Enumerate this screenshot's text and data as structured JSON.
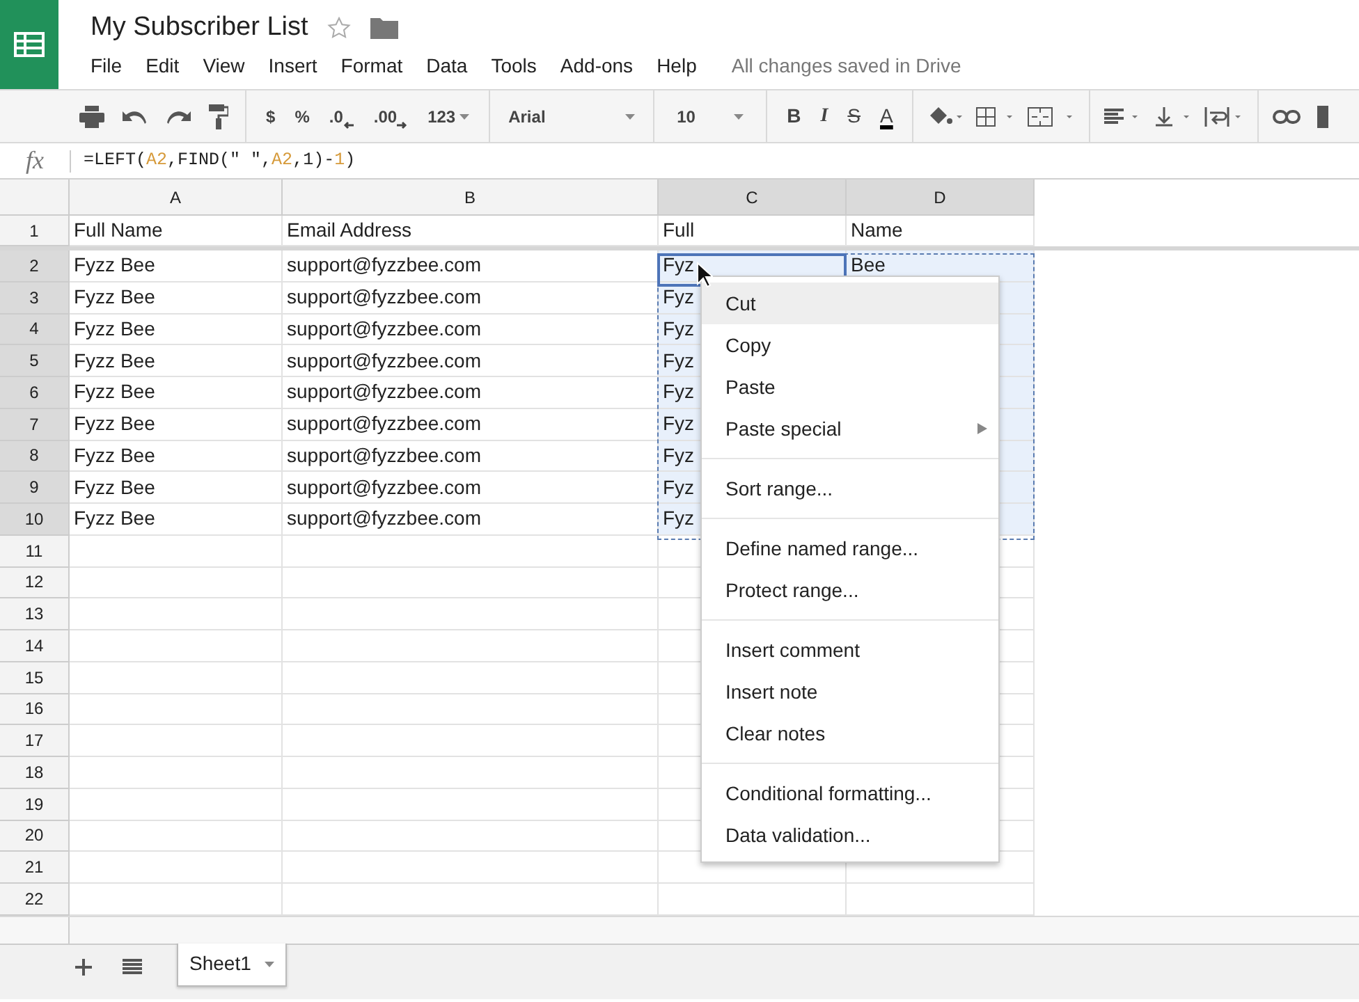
{
  "document": {
    "title": "My Subscriber List",
    "starred": false
  },
  "menu_bar": [
    "File",
    "Edit",
    "View",
    "Insert",
    "Format",
    "Data",
    "Tools",
    "Add-ons",
    "Help"
  ],
  "save_status": "All changes saved in Drive",
  "toolbar": {
    "number_formats": [
      "$",
      "%",
      ".0",
      ".00",
      "123"
    ],
    "font": "Arial",
    "font_size": "10",
    "text_styles": [
      "B",
      "I",
      "S",
      "A"
    ]
  },
  "formula_bar": {
    "label": "fx",
    "tokens": [
      {
        "text": "=LEFT(",
        "color": "#222222"
      },
      {
        "text": "A2",
        "color": "#d69a3a"
      },
      {
        "text": ",FIND(\" \",",
        "color": "#222222"
      },
      {
        "text": "A2",
        "color": "#d69a3a"
      },
      {
        "text": ",1)-",
        "color": "#222222"
      },
      {
        "text": "1",
        "color": "#d69a3a"
      },
      {
        "text": ")",
        "color": "#222222"
      }
    ]
  },
  "columns": [
    {
      "letter": "A",
      "selected": false
    },
    {
      "letter": "B",
      "selected": false
    },
    {
      "letter": "C",
      "selected": true
    },
    {
      "letter": "D",
      "selected": true
    }
  ],
  "rows": [
    {
      "number": "1",
      "selected": false,
      "cells": [
        "Full Name",
        "Email Address",
        "Full",
        "Name"
      ]
    },
    {
      "number": "2",
      "selected": true,
      "cells": [
        "Fyzz Bee",
        "support@fyzzbee.com",
        "Fyz",
        "Bee"
      ]
    },
    {
      "number": "3",
      "selected": true,
      "cells": [
        "Fyzz Bee",
        "support@fyzzbee.com",
        "Fyz",
        ""
      ]
    },
    {
      "number": "4",
      "selected": true,
      "cells": [
        "Fyzz Bee",
        "support@fyzzbee.com",
        "Fyz",
        ""
      ]
    },
    {
      "number": "5",
      "selected": true,
      "cells": [
        "Fyzz Bee",
        "support@fyzzbee.com",
        "Fyz",
        ""
      ]
    },
    {
      "number": "6",
      "selected": true,
      "cells": [
        "Fyzz Bee",
        "support@fyzzbee.com",
        "Fyz",
        ""
      ]
    },
    {
      "number": "7",
      "selected": true,
      "cells": [
        "Fyzz Bee",
        "support@fyzzbee.com",
        "Fyz",
        ""
      ]
    },
    {
      "number": "8",
      "selected": true,
      "cells": [
        "Fyzz Bee",
        "support@fyzzbee.com",
        "Fyz",
        ""
      ]
    },
    {
      "number": "9",
      "selected": true,
      "cells": [
        "Fyzz Bee",
        "support@fyzzbee.com",
        "Fyz",
        ""
      ]
    },
    {
      "number": "10",
      "selected": true,
      "cells": [
        "Fyzz Bee",
        "support@fyzzbee.com",
        "Fyz",
        ""
      ]
    },
    {
      "number": "11",
      "selected": false,
      "cells": [
        "",
        "",
        "",
        ""
      ]
    },
    {
      "number": "12",
      "selected": false,
      "cells": [
        "",
        "",
        "",
        ""
      ]
    },
    {
      "number": "13",
      "selected": false,
      "cells": [
        "",
        "",
        "",
        ""
      ]
    },
    {
      "number": "14",
      "selected": false,
      "cells": [
        "",
        "",
        "",
        ""
      ]
    },
    {
      "number": "15",
      "selected": false,
      "cells": [
        "",
        "",
        "",
        ""
      ]
    },
    {
      "number": "16",
      "selected": false,
      "cells": [
        "",
        "",
        "",
        ""
      ]
    },
    {
      "number": "17",
      "selected": false,
      "cells": [
        "",
        "",
        "",
        ""
      ]
    },
    {
      "number": "18",
      "selected": false,
      "cells": [
        "",
        "",
        "",
        ""
      ]
    },
    {
      "number": "19",
      "selected": false,
      "cells": [
        "",
        "",
        "",
        ""
      ]
    },
    {
      "number": "20",
      "selected": false,
      "cells": [
        "",
        "",
        "",
        ""
      ]
    },
    {
      "number": "21",
      "selected": false,
      "cells": [
        "",
        "",
        "",
        ""
      ]
    },
    {
      "number": "22",
      "selected": false,
      "cells": [
        "",
        "",
        "",
        ""
      ]
    }
  ],
  "context_menu": {
    "groups": [
      [
        {
          "label": "Cut",
          "selected": true,
          "submenu": false
        },
        {
          "label": "Copy",
          "selected": false,
          "submenu": false
        },
        {
          "label": "Paste",
          "selected": false,
          "submenu": false
        },
        {
          "label": "Paste special",
          "selected": false,
          "submenu": true
        }
      ],
      [
        {
          "label": "Sort range...",
          "selected": false,
          "submenu": false
        }
      ],
      [
        {
          "label": "Define named range...",
          "selected": false,
          "submenu": false
        },
        {
          "label": "Protect range...",
          "selected": false,
          "submenu": false
        }
      ],
      [
        {
          "label": "Insert comment",
          "selected": false,
          "submenu": false
        },
        {
          "label": "Insert note",
          "selected": false,
          "submenu": false
        },
        {
          "label": "Clear notes",
          "selected": false,
          "submenu": false
        }
      ],
      [
        {
          "label": "Conditional formatting...",
          "selected": false,
          "submenu": false
        },
        {
          "label": "Data validation...",
          "selected": false,
          "submenu": false
        }
      ]
    ]
  },
  "sheet_tabs": [
    {
      "label": "Sheet1",
      "selected": true
    }
  ]
}
